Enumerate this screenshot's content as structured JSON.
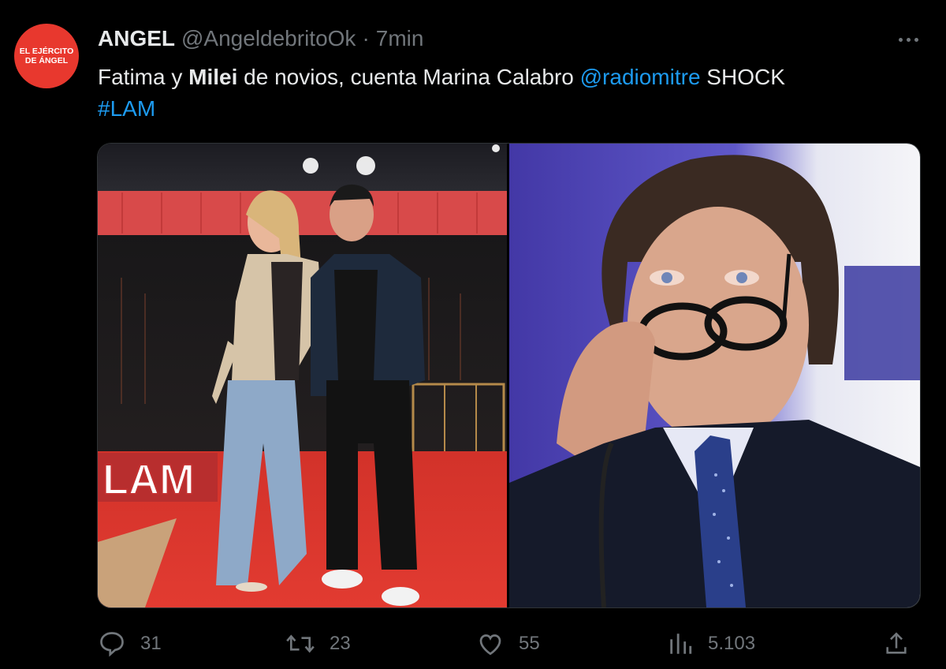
{
  "tweet": {
    "avatar_text_line1": "EL EJÉRCITO",
    "avatar_text_line2": "DE ÁNGEL",
    "author_name": "ANGEL",
    "author_handle": "@AngeldebritoOk",
    "separator": "·",
    "time": "7min",
    "text_part1": "Fatima y ",
    "text_bold": "Milei",
    "text_part2": " de novios, cuenta Marina Calabro ",
    "mention": "@radiomitre",
    "text_part3": " SHOCK",
    "hashtag": "#LAM",
    "accent_color": "#1d9bf0",
    "avatar_color": "#e8382e"
  },
  "media": {
    "left_sign": "LAM"
  },
  "actions": {
    "replies": "31",
    "retweets": "23",
    "likes": "55",
    "views": "5.103"
  }
}
